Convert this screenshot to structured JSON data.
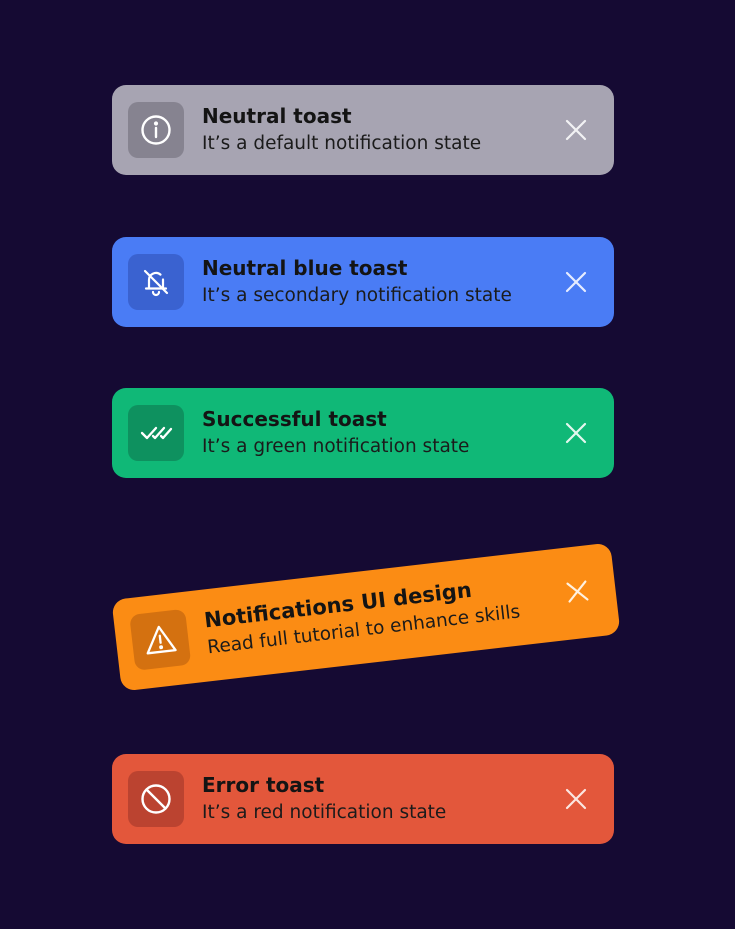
{
  "toasts": [
    {
      "title": "Neutral toast",
      "message": "It’s a default notification state",
      "icon": "info-icon",
      "colors": {
        "background": "#a7a4b2",
        "icon_box": "#868390"
      }
    },
    {
      "title": "Neutral blue toast",
      "message": "It’s a secondary notification state",
      "icon": "bell-off-icon",
      "colors": {
        "background": "#4a7cf5",
        "icon_box": "#3a62d0"
      }
    },
    {
      "title": "Successful toast",
      "message": "It’s a green notification state",
      "icon": "double-check-icon",
      "colors": {
        "background": "#10b877",
        "icon_box": "#0e915f"
      }
    },
    {
      "title": "Notifications UI design",
      "message": "Read full tutorial to enhance skills",
      "icon": "warning-icon",
      "colors": {
        "background": "#fb8c14",
        "icon_box": "#d47110"
      }
    },
    {
      "title": "Error toast",
      "message": "It’s a red notification state",
      "icon": "block-icon",
      "colors": {
        "background": "#e3573b",
        "icon_box": "#bb4330"
      }
    }
  ],
  "close_icon": "close-icon"
}
